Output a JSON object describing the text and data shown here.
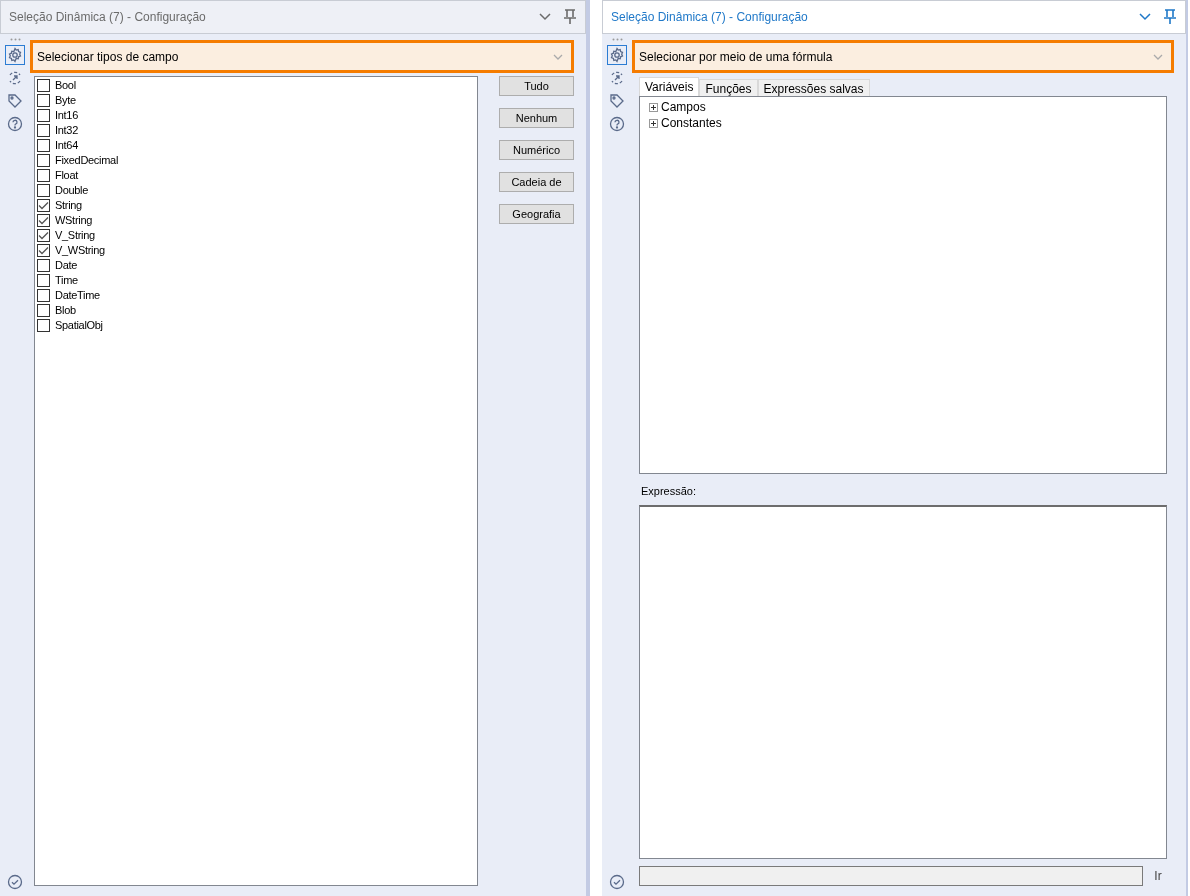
{
  "panels": [
    {
      "kind": "field_types",
      "title": "Seleção Dinâmica (7) - Configuração",
      "active": false,
      "sidebar_tabs": [
        {
          "kind": "settings",
          "selected": true
        },
        {
          "kind": "connection",
          "selected": false
        },
        {
          "kind": "tag",
          "selected": false
        },
        {
          "kind": "help",
          "selected": false
        }
      ],
      "mode": "Selecionar tipos de campo",
      "field_types": [
        {
          "label": "Bool",
          "checked": false
        },
        {
          "label": "Byte",
          "checked": false
        },
        {
          "label": "Int16",
          "checked": false
        },
        {
          "label": "Int32",
          "checked": false
        },
        {
          "label": "Int64",
          "checked": false
        },
        {
          "label": "FixedDecimal",
          "checked": false
        },
        {
          "label": "Float",
          "checked": false
        },
        {
          "label": "Double",
          "checked": false
        },
        {
          "label": "String",
          "checked": true
        },
        {
          "label": "WString",
          "checked": true
        },
        {
          "label": "V_String",
          "checked": true
        },
        {
          "label": "V_WString",
          "checked": true
        },
        {
          "label": "Date",
          "checked": false
        },
        {
          "label": "Time",
          "checked": false
        },
        {
          "label": "DateTime",
          "checked": false
        },
        {
          "label": "Blob",
          "checked": false
        },
        {
          "label": "SpatialObj",
          "checked": false
        }
      ],
      "buttons": [
        "Tudo",
        "Nenhum",
        "Numérico",
        "Cadeia de",
        "Geografia"
      ]
    },
    {
      "kind": "formula",
      "title": "Seleção Dinâmica (7) - Configuração",
      "active": true,
      "sidebar_tabs": [
        {
          "kind": "settings",
          "selected": true
        },
        {
          "kind": "connection",
          "selected": false
        },
        {
          "kind": "tag",
          "selected": false
        },
        {
          "kind": "help",
          "selected": false
        }
      ],
      "mode": "Selecionar por meio de uma fórmula",
      "tabs": [
        {
          "label": "Variáveis",
          "selected": true
        },
        {
          "label": "Funções",
          "selected": false
        },
        {
          "label": "Expressões salvas",
          "selected": false
        }
      ],
      "tree": [
        {
          "label": "Campos",
          "expanded": false
        },
        {
          "label": "Constantes",
          "expanded": false
        }
      ],
      "expression_label": "Expressão:",
      "go_button": "Ir"
    }
  ]
}
